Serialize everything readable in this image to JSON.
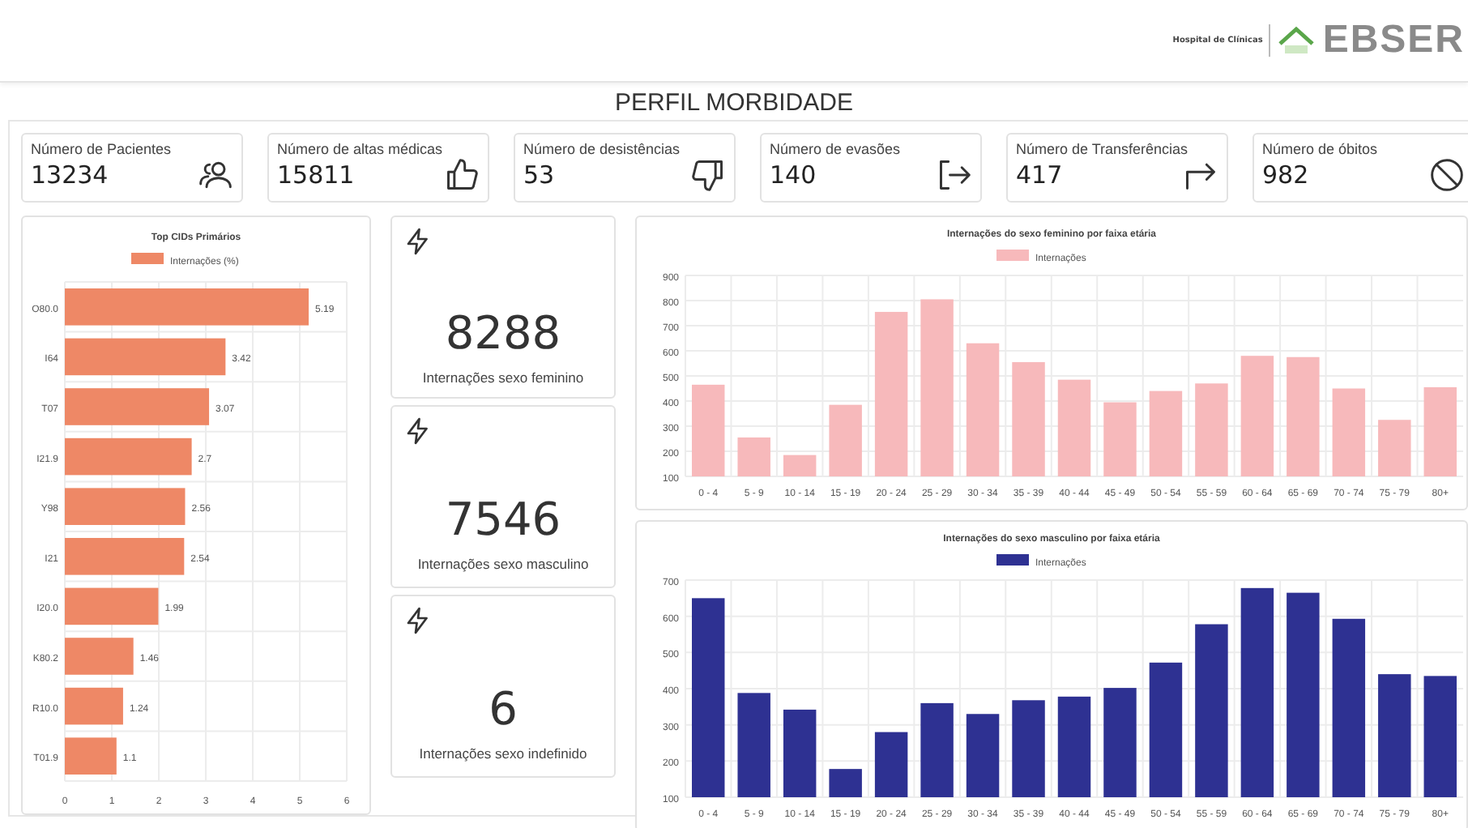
{
  "header": {
    "hospital_label": "Hospital de Clínicas",
    "brand": "EBSER"
  },
  "title": "PERFIL MORBIDADE",
  "kpis": [
    {
      "label": "Número de Pacientes",
      "value": "13234"
    },
    {
      "label": "Número de altas médicas",
      "value": "15811"
    },
    {
      "label": "Número de desistências",
      "value": "53"
    },
    {
      "label": "Número de evasões",
      "value": "140"
    },
    {
      "label": "Número de Transferências",
      "value": "417"
    },
    {
      "label": "Número de óbitos",
      "value": "982"
    }
  ],
  "cid_chart": {
    "chart_data": {
      "type": "bar",
      "orientation": "horizontal",
      "title": "Top CIDs Primários",
      "categories": [
        "O80.0",
        "I64",
        "T07",
        "I21.9",
        "Y98",
        "I21",
        "I20.0",
        "K80.2",
        "R10.0",
        "T01.9"
      ],
      "series": [
        {
          "name": "Internações (%)",
          "color": "#ee8866",
          "values": [
            5.19,
            3.42,
            3.07,
            2.7,
            2.56,
            2.54,
            1.99,
            1.46,
            1.24,
            1.1
          ]
        }
      ],
      "xlim": [
        0,
        6
      ],
      "xticks": [
        0,
        1,
        2,
        3,
        4,
        5,
        6
      ],
      "data_labels": true,
      "grid": true
    }
  },
  "sex_cards": [
    {
      "value": "8288",
      "label": "Internações sexo feminino"
    },
    {
      "value": "7546",
      "label": "Internações sexo masculino"
    },
    {
      "value": "6",
      "label": "Internações sexo indefinido"
    }
  ],
  "female_chart": {
    "chart_data": {
      "type": "bar",
      "title": "Internações do sexo feminino por faixa etária",
      "categories": [
        "0 - 4",
        "5 - 9",
        "10 - 14",
        "15 - 19",
        "20 - 24",
        "25 - 29",
        "30 - 34",
        "35 - 39",
        "40 - 44",
        "45 - 49",
        "50 - 54",
        "55 - 59",
        "60 - 64",
        "65 - 69",
        "70 - 74",
        "75 - 79",
        "80+"
      ],
      "series": [
        {
          "name": "Internações",
          "color": "#f7b9bb",
          "values": [
            465,
            255,
            185,
            385,
            755,
            805,
            630,
            555,
            485,
            395,
            440,
            470,
            580,
            575,
            450,
            325,
            455
          ]
        }
      ],
      "ylim": [
        100,
        900
      ],
      "yticks": [
        100,
        200,
        300,
        400,
        500,
        600,
        700,
        800,
        900
      ],
      "grid": true
    }
  },
  "male_chart": {
    "chart_data": {
      "type": "bar",
      "title": "Internações do sexo masculino por faixa etária",
      "categories": [
        "0 - 4",
        "5 - 9",
        "10 - 14",
        "15 - 19",
        "20 - 24",
        "25 - 29",
        "30 - 34",
        "35 - 39",
        "40 - 44",
        "45 - 49",
        "50 - 54",
        "55 - 59",
        "60 - 64",
        "65 - 69",
        "70 - 74",
        "75 - 79",
        "80+"
      ],
      "series": [
        {
          "name": "Internações",
          "color": "#2e3192",
          "values": [
            650,
            388,
            342,
            178,
            280,
            360,
            330,
            368,
            378,
            402,
            472,
            578,
            678,
            665,
            593,
            440,
            435
          ]
        }
      ],
      "ylim": [
        100,
        700
      ],
      "yticks": [
        100,
        200,
        300,
        400,
        500,
        600,
        700
      ],
      "grid": true
    }
  }
}
